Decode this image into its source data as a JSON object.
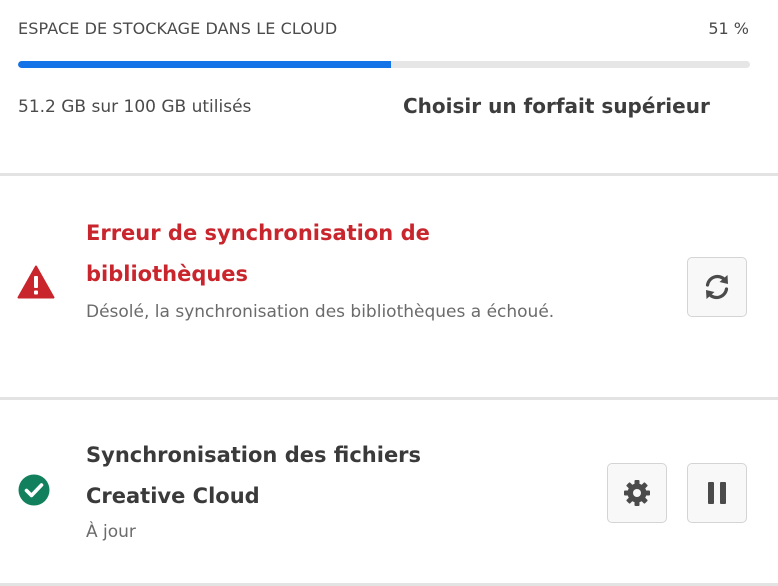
{
  "storage": {
    "label": "ESPACE DE STOCKAGE DANS LE CLOUD",
    "percent_text": "51 %",
    "percent_value": 51,
    "usage_text": "51.2 GB sur 100 GB utilisés",
    "upgrade_label": "Choisir un forfait supérieur",
    "bar_color": "#1473e6"
  },
  "library_sync": {
    "status_icon": "warning-icon",
    "title": "Erreur de synchronisation de bibliothèques",
    "description": "Désolé, la synchronisation des bibliothèques a échoué.",
    "title_color": "#c9252d",
    "action_icon": "refresh-icon"
  },
  "files_sync": {
    "status_icon": "check-circle-icon",
    "title": "Synchronisation des fichiers Creative Cloud",
    "status": "À jour",
    "status_color": "#12805c",
    "actions": [
      "gear-icon",
      "pause-icon"
    ]
  }
}
